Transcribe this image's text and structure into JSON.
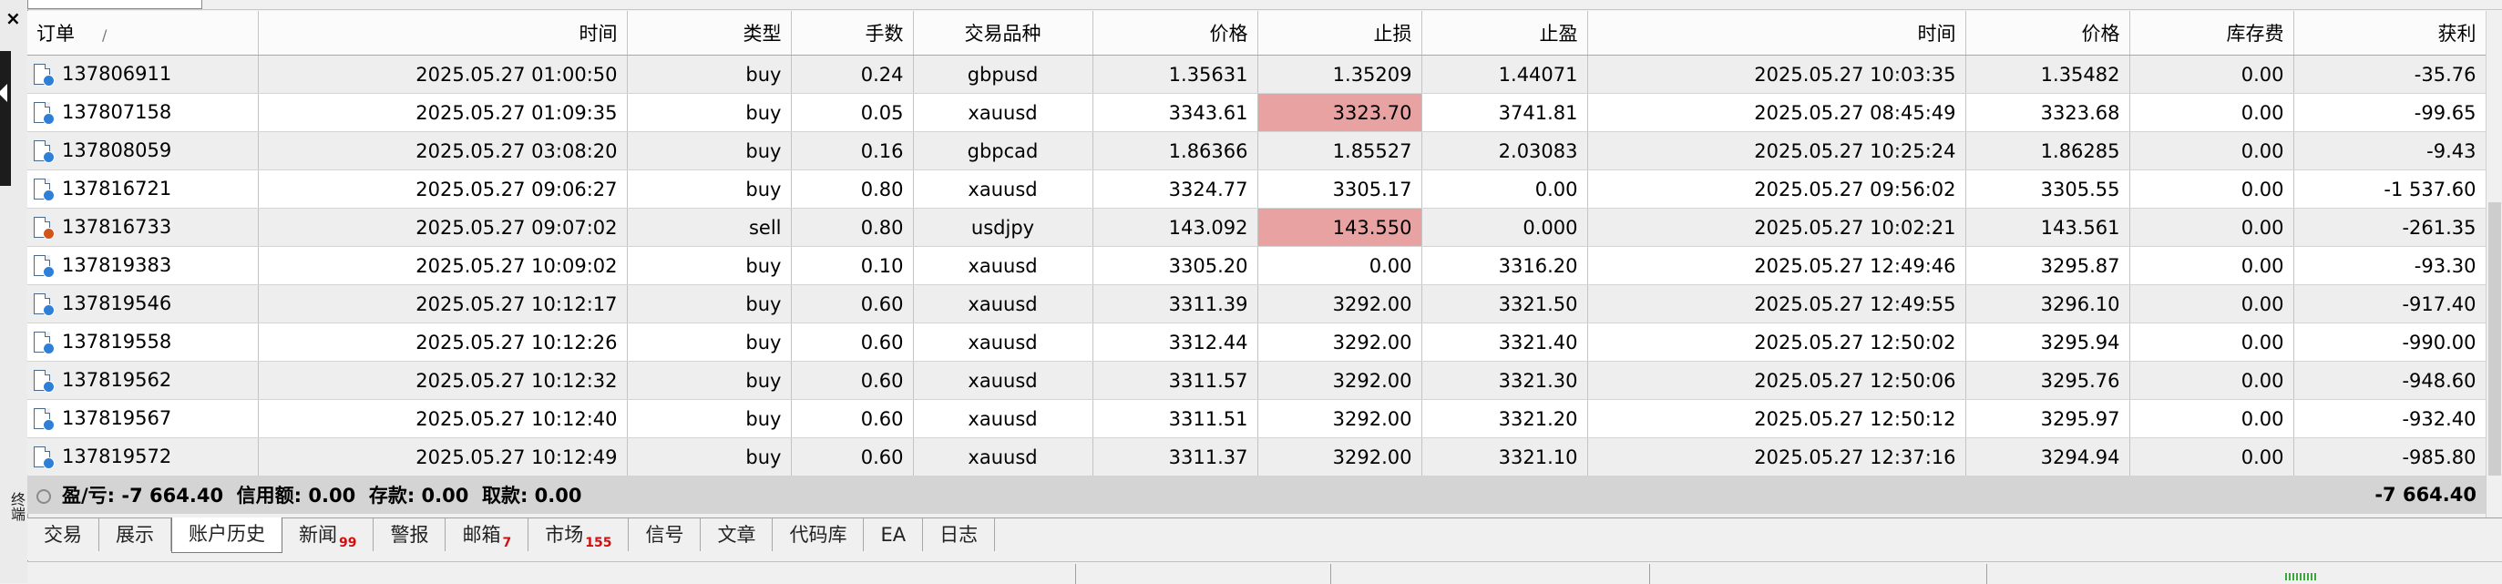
{
  "window": {
    "close_label": "×",
    "side_label": "终端"
  },
  "columns": [
    {
      "key": "order",
      "label": "订单",
      "sort_indicator": "/"
    },
    {
      "key": "open_time",
      "label": "时间"
    },
    {
      "key": "type",
      "label": "类型"
    },
    {
      "key": "lots",
      "label": "手数"
    },
    {
      "key": "symbol",
      "label": "交易品种"
    },
    {
      "key": "open_price",
      "label": "价格"
    },
    {
      "key": "sl",
      "label": "止损"
    },
    {
      "key": "tp",
      "label": "止盈"
    },
    {
      "key": "close_time",
      "label": "时间"
    },
    {
      "key": "close_price",
      "label": "价格"
    },
    {
      "key": "swap",
      "label": "库存费"
    },
    {
      "key": "profit",
      "label": "获利"
    }
  ],
  "rows": [
    {
      "order": "137806911",
      "open_time": "2025.05.27 01:00:50",
      "type": "buy",
      "lots": "0.24",
      "symbol": "gbpusd",
      "open_price": "1.35631",
      "sl": "1.35209",
      "tp": "1.44071",
      "close_time": "2025.05.27 10:03:35",
      "close_price": "1.35482",
      "swap": "0.00",
      "profit": "-35.76",
      "sl_hit": false,
      "icon": "buy"
    },
    {
      "order": "137807158",
      "open_time": "2025.05.27 01:09:35",
      "type": "buy",
      "lots": "0.05",
      "symbol": "xauusd",
      "open_price": "3343.61",
      "sl": "3323.70",
      "tp": "3741.81",
      "close_time": "2025.05.27 08:45:49",
      "close_price": "3323.68",
      "swap": "0.00",
      "profit": "-99.65",
      "sl_hit": true,
      "icon": "buy"
    },
    {
      "order": "137808059",
      "open_time": "2025.05.27 03:08:20",
      "type": "buy",
      "lots": "0.16",
      "symbol": "gbpcad",
      "open_price": "1.86366",
      "sl": "1.85527",
      "tp": "2.03083",
      "close_time": "2025.05.27 10:25:24",
      "close_price": "1.86285",
      "swap": "0.00",
      "profit": "-9.43",
      "sl_hit": false,
      "icon": "buy"
    },
    {
      "order": "137816721",
      "open_time": "2025.05.27 09:06:27",
      "type": "buy",
      "lots": "0.80",
      "symbol": "xauusd",
      "open_price": "3324.77",
      "sl": "3305.17",
      "tp": "0.00",
      "close_time": "2025.05.27 09:56:02",
      "close_price": "3305.55",
      "swap": "0.00",
      "profit": "-1 537.60",
      "sl_hit": false,
      "icon": "buy"
    },
    {
      "order": "137816733",
      "open_time": "2025.05.27 09:07:02",
      "type": "sell",
      "lots": "0.80",
      "symbol": "usdjpy",
      "open_price": "143.092",
      "sl": "143.550",
      "tp": "0.000",
      "close_time": "2025.05.27 10:02:21",
      "close_price": "143.561",
      "swap": "0.00",
      "profit": "-261.35",
      "sl_hit": true,
      "icon": "sell"
    },
    {
      "order": "137819383",
      "open_time": "2025.05.27 10:09:02",
      "type": "buy",
      "lots": "0.10",
      "symbol": "xauusd",
      "open_price": "3305.20",
      "sl": "0.00",
      "tp": "3316.20",
      "close_time": "2025.05.27 12:49:46",
      "close_price": "3295.87",
      "swap": "0.00",
      "profit": "-93.30",
      "sl_hit": false,
      "icon": "buy"
    },
    {
      "order": "137819546",
      "open_time": "2025.05.27 10:12:17",
      "type": "buy",
      "lots": "0.60",
      "symbol": "xauusd",
      "open_price": "3311.39",
      "sl": "3292.00",
      "tp": "3321.50",
      "close_time": "2025.05.27 12:49:55",
      "close_price": "3296.10",
      "swap": "0.00",
      "profit": "-917.40",
      "sl_hit": false,
      "icon": "buy"
    },
    {
      "order": "137819558",
      "open_time": "2025.05.27 10:12:26",
      "type": "buy",
      "lots": "0.60",
      "symbol": "xauusd",
      "open_price": "3312.44",
      "sl": "3292.00",
      "tp": "3321.40",
      "close_time": "2025.05.27 12:50:02",
      "close_price": "3295.94",
      "swap": "0.00",
      "profit": "-990.00",
      "sl_hit": false,
      "icon": "buy"
    },
    {
      "order": "137819562",
      "open_time": "2025.05.27 10:12:32",
      "type": "buy",
      "lots": "0.60",
      "symbol": "xauusd",
      "open_price": "3311.57",
      "sl": "3292.00",
      "tp": "3321.30",
      "close_time": "2025.05.27 12:50:06",
      "close_price": "3295.76",
      "swap": "0.00",
      "profit": "-948.60",
      "sl_hit": false,
      "icon": "buy"
    },
    {
      "order": "137819567",
      "open_time": "2025.05.27 10:12:40",
      "type": "buy",
      "lots": "0.60",
      "symbol": "xauusd",
      "open_price": "3311.51",
      "sl": "3292.00",
      "tp": "3321.20",
      "close_time": "2025.05.27 12:50:12",
      "close_price": "3295.97",
      "swap": "0.00",
      "profit": "-932.40",
      "sl_hit": false,
      "icon": "buy"
    },
    {
      "order": "137819572",
      "open_time": "2025.05.27 10:12:49",
      "type": "buy",
      "lots": "0.60",
      "symbol": "xauusd",
      "open_price": "3311.37",
      "sl": "3292.00",
      "tp": "3321.10",
      "close_time": "2025.05.27 12:37:16",
      "close_price": "3294.94",
      "swap": "0.00",
      "profit": "-985.80",
      "sl_hit": false,
      "icon": "buy"
    }
  ],
  "summary": {
    "text": "盈/亏: -7 664.40  信用额: 0.00  存款: 0.00  取款: 0.00",
    "total": "-7 664.40"
  },
  "tabs": [
    {
      "label": "交易",
      "badge": ""
    },
    {
      "label": "展示",
      "badge": ""
    },
    {
      "label": "账户历史",
      "badge": "",
      "active": true
    },
    {
      "label": "新闻",
      "badge": "99"
    },
    {
      "label": "警报",
      "badge": ""
    },
    {
      "label": "邮箱",
      "badge": "7"
    },
    {
      "label": "市场",
      "badge": "155"
    },
    {
      "label": "信号",
      "badge": ""
    },
    {
      "label": "文章",
      "badge": ""
    },
    {
      "label": "代码库",
      "badge": ""
    },
    {
      "label": "EA",
      "badge": ""
    },
    {
      "label": "日志",
      "badge": ""
    }
  ],
  "colors": {
    "sl_highlight": "#e8a2a2",
    "buy_icon": "#2f7fd6",
    "sell_icon": "#d2541c",
    "badge_red": "#d01010",
    "summary_bg": "#d4d4d4"
  }
}
